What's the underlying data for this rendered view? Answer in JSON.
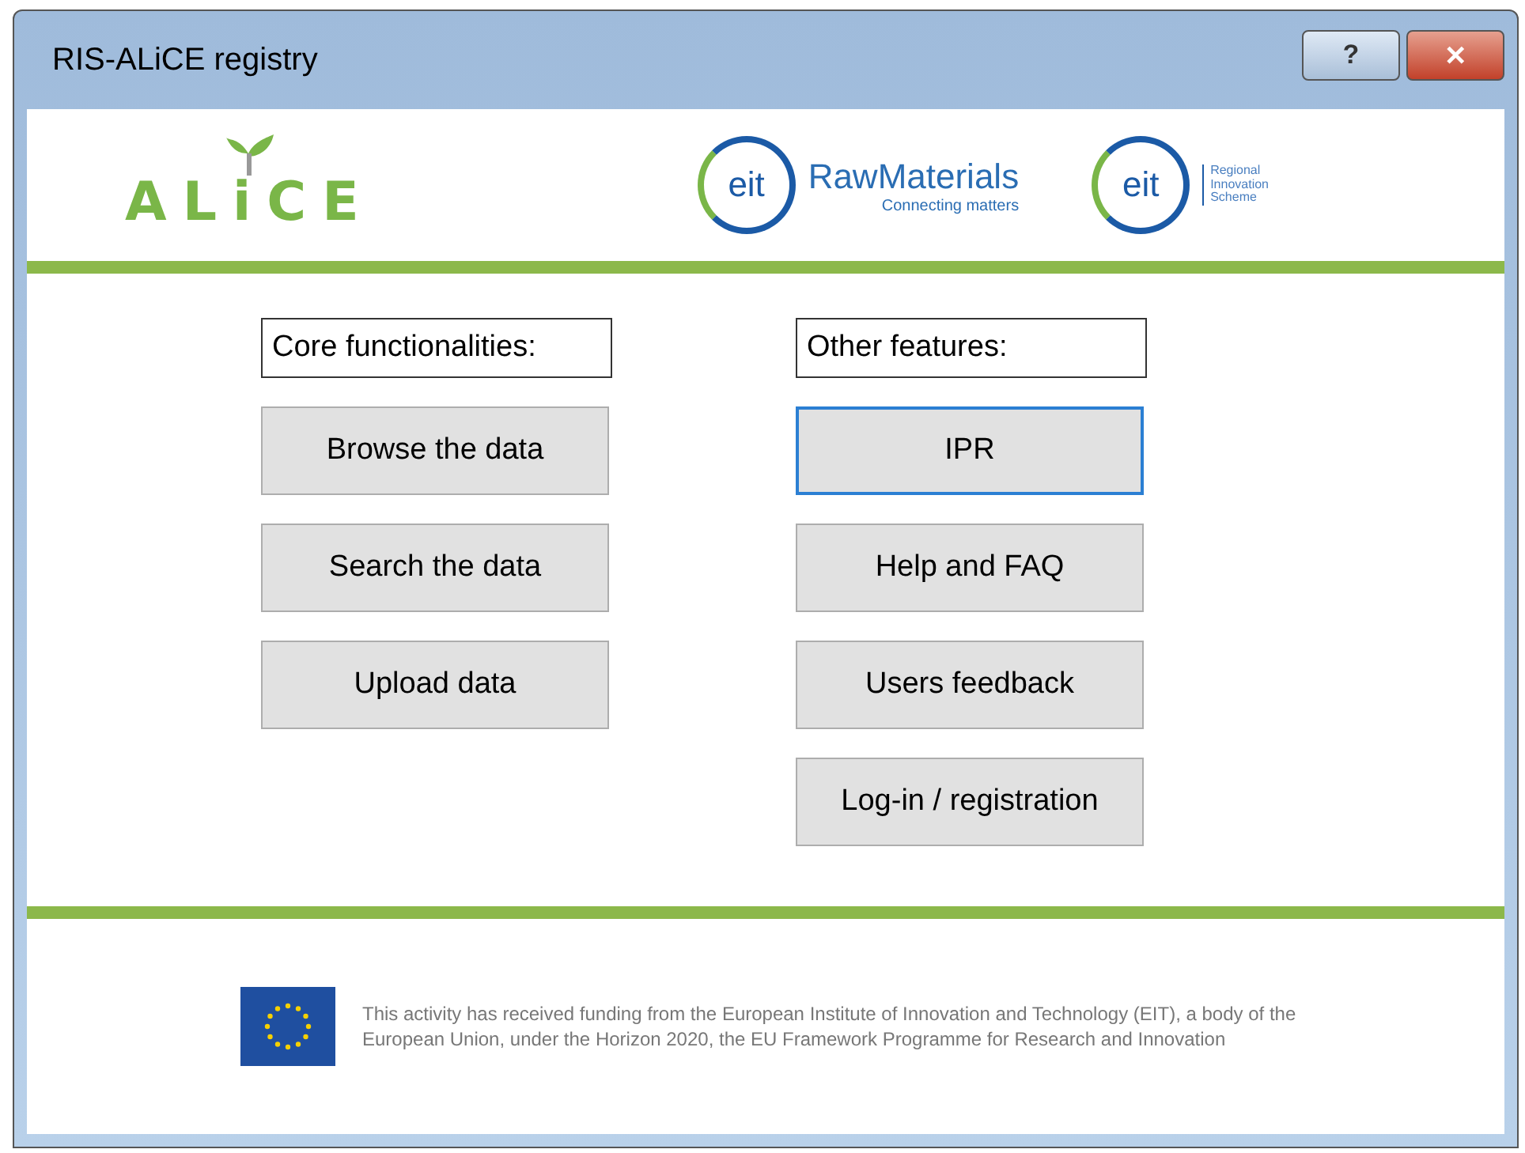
{
  "window": {
    "title": "RIS-ALiCE registry",
    "controls": [
      {
        "kind": "help",
        "label": "?"
      },
      {
        "kind": "close",
        "label": "✕"
      }
    ]
  },
  "header": {
    "alice_logo": "ALiCE",
    "rawmaterials_logo": {
      "mark": "eit",
      "name": "RawMaterials",
      "tagline": "Connecting matters"
    },
    "ris_logo": {
      "mark": "eit",
      "lines": [
        "Regional",
        "Innovation",
        "Scheme"
      ]
    }
  },
  "columns": [
    {
      "heading": "Core functionalities:",
      "buttons": [
        {
          "label": "Browse the data",
          "focused": false
        },
        {
          "label": "Search the data",
          "focused": false
        },
        {
          "label": "Upload data",
          "focused": false
        }
      ]
    },
    {
      "heading": "Other features:",
      "buttons": [
        {
          "label": "IPR",
          "focused": true
        },
        {
          "label": "Help and FAQ",
          "focused": false
        },
        {
          "label": "Users feedback",
          "focused": false
        },
        {
          "label": "Log-in / registration",
          "focused": false
        }
      ]
    }
  ],
  "footer": {
    "text": "This activity has received funding from the European Institute of Innovation and Technology (EIT), a body of the European Union, under the Horizon 2020, the EU Framework Programme for Research and Innovation"
  }
}
